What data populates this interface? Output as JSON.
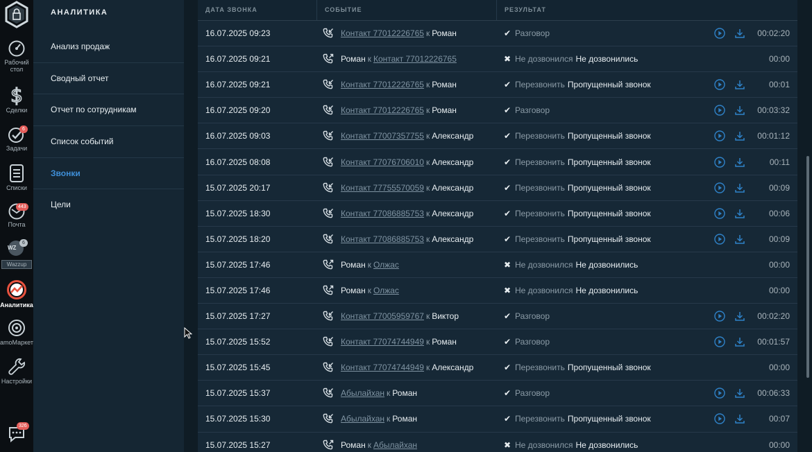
{
  "rail": {
    "items": [
      {
        "label_line1": "Рабочий",
        "label_line2": "стол",
        "icon": "dashboard-icon"
      },
      {
        "label": "Сделки",
        "icon": "dollar-icon"
      },
      {
        "label": "Задачи",
        "icon": "check-circle-icon",
        "badge": "6"
      },
      {
        "label": "Списки",
        "icon": "lists-icon"
      },
      {
        "label": "Почта",
        "icon": "mail-icon",
        "badge": "443"
      },
      {
        "label": "Wazzup",
        "icon": "wazzup-icon",
        "badge": "6",
        "avatar_text": "WZ"
      },
      {
        "label": "Аналитика",
        "icon": "analytics-icon"
      },
      {
        "label": "amoМаркет",
        "icon": "market-icon"
      },
      {
        "label": "Настройки",
        "icon": "wrench-icon"
      },
      {
        "label": "",
        "icon": "chat-icon",
        "badge": "326"
      }
    ]
  },
  "submenu": {
    "title": "АНАЛИТИКА",
    "items": [
      {
        "label": "Анализ продаж"
      },
      {
        "label": "Сводный отчет"
      },
      {
        "label": "Отчет по сотрудникам"
      },
      {
        "label": "Список событий"
      },
      {
        "label": "Звонки"
      },
      {
        "label": "Цели"
      }
    ]
  },
  "table": {
    "headers": [
      "ДАТА ЗВОНКА",
      "СОБЫТИЕ",
      "РЕЗУЛЬТАТ"
    ],
    "rows": [
      {
        "date": "16.07.2025 09:23",
        "dir": "in",
        "from": "Контакт 77012226765",
        "from_link": true,
        "to_word": "к",
        "to": "Роман",
        "to_link": false,
        "ok": true,
        "status": "Разговор",
        "result": "",
        "media": true,
        "duration": "00:02:20"
      },
      {
        "date": "16.07.2025 09:21",
        "dir": "out",
        "from": "Роман",
        "from_link": false,
        "to_word": "к",
        "to": "Контакт 77012226765",
        "to_link": true,
        "ok": false,
        "status": "Не дозвонился",
        "result": "Не дозвонились",
        "media": false,
        "duration": "00:00"
      },
      {
        "date": "16.07.2025 09:21",
        "dir": "in",
        "from": "Контакт 77012226765",
        "from_link": true,
        "to_word": "к",
        "to": "Роман",
        "to_link": false,
        "ok": true,
        "status": "Перезвонить",
        "result": "Пропущенный звонок",
        "media": true,
        "duration": "00:01"
      },
      {
        "date": "16.07.2025 09:20",
        "dir": "in",
        "from": "Контакт 77012226765",
        "from_link": true,
        "to_word": "к",
        "to": "Роман",
        "to_link": false,
        "ok": true,
        "status": "Разговор",
        "result": "",
        "media": true,
        "duration": "00:03:32"
      },
      {
        "date": "16.07.2025 09:03",
        "dir": "in",
        "from": "Контакт 77007357755",
        "from_link": true,
        "to_word": "к",
        "to": "Александр",
        "to_link": false,
        "ok": true,
        "status": "Перезвонить",
        "result": "Пропущенный звонок",
        "media": true,
        "duration": "00:01:12"
      },
      {
        "date": "16.07.2025 08:08",
        "dir": "in",
        "from": "Контакт 77076706010",
        "from_link": true,
        "to_word": "к",
        "to": "Александр",
        "to_link": false,
        "ok": true,
        "status": "Перезвонить",
        "result": "Пропущенный звонок",
        "media": true,
        "duration": "00:11"
      },
      {
        "date": "15.07.2025 20:17",
        "dir": "in",
        "from": "Контакт 77755570059",
        "from_link": true,
        "to_word": "к",
        "to": "Александр",
        "to_link": false,
        "ok": true,
        "status": "Перезвонить",
        "result": "Пропущенный звонок",
        "media": true,
        "duration": "00:09"
      },
      {
        "date": "15.07.2025 18:30",
        "dir": "in",
        "from": "Контакт 77086885753",
        "from_link": true,
        "to_word": "к",
        "to": "Александр",
        "to_link": false,
        "ok": true,
        "status": "Перезвонить",
        "result": "Пропущенный звонок",
        "media": true,
        "duration": "00:06"
      },
      {
        "date": "15.07.2025 18:20",
        "dir": "in",
        "from": "Контакт 77086885753",
        "from_link": true,
        "to_word": "к",
        "to": "Александр",
        "to_link": false,
        "ok": true,
        "status": "Перезвонить",
        "result": "Пропущенный звонок",
        "media": true,
        "duration": "00:09"
      },
      {
        "date": "15.07.2025 17:46",
        "dir": "out",
        "from": "Роман",
        "from_link": false,
        "to_word": "к",
        "to": "Олжас",
        "to_link": true,
        "ok": false,
        "status": "Не дозвонился",
        "result": "Не дозвонились",
        "media": false,
        "duration": "00:00"
      },
      {
        "date": "15.07.2025 17:46",
        "dir": "out",
        "from": "Роман",
        "from_link": false,
        "to_word": "к",
        "to": "Олжас",
        "to_link": true,
        "ok": false,
        "status": "Не дозвонился",
        "result": "Не дозвонились",
        "media": false,
        "duration": "00:00"
      },
      {
        "date": "15.07.2025 17:27",
        "dir": "in",
        "from": "Контакт 77005959767",
        "from_link": true,
        "to_word": "к",
        "to": "Виктор",
        "to_link": false,
        "ok": true,
        "status": "Разговор",
        "result": "",
        "media": true,
        "duration": "00:02:20"
      },
      {
        "date": "15.07.2025 15:52",
        "dir": "in",
        "from": "Контакт 77074744949",
        "from_link": true,
        "to_word": "к",
        "to": "Роман",
        "to_link": false,
        "ok": true,
        "status": "Разговор",
        "result": "",
        "media": true,
        "duration": "00:01:57"
      },
      {
        "date": "15.07.2025 15:45",
        "dir": "in",
        "from": "Контакт 77074744949",
        "from_link": true,
        "to_word": "к",
        "to": "Александр",
        "to_link": false,
        "ok": true,
        "status": "Перезвонить",
        "result": "Пропущенный звонок",
        "media": false,
        "duration": "00:00"
      },
      {
        "date": "15.07.2025 15:37",
        "dir": "in",
        "from": "Абылайхан",
        "from_link": true,
        "to_word": "к",
        "to": "Роман",
        "to_link": false,
        "ok": true,
        "status": "Разговор",
        "result": "",
        "media": true,
        "duration": "00:06:33"
      },
      {
        "date": "15.07.2025 15:30",
        "dir": "in",
        "from": "Абылайхан",
        "from_link": true,
        "to_word": "к",
        "to": "Роман",
        "to_link": false,
        "ok": true,
        "status": "Перезвонить",
        "result": "Пропущенный звонок",
        "media": true,
        "duration": "00:07"
      },
      {
        "date": "15.07.2025 15:27",
        "dir": "out",
        "from": "Роман",
        "from_link": false,
        "to_word": "к",
        "to": "Абылайхан",
        "to_link": true,
        "ok": false,
        "status": "Не дозвонился",
        "result": "Не дозвонились",
        "media": false,
        "duration": "00:00"
      }
    ]
  },
  "colors": {
    "accent": "#3f8fd8",
    "badge": "#e45d5a",
    "analytics_icon": "#e8523f"
  }
}
